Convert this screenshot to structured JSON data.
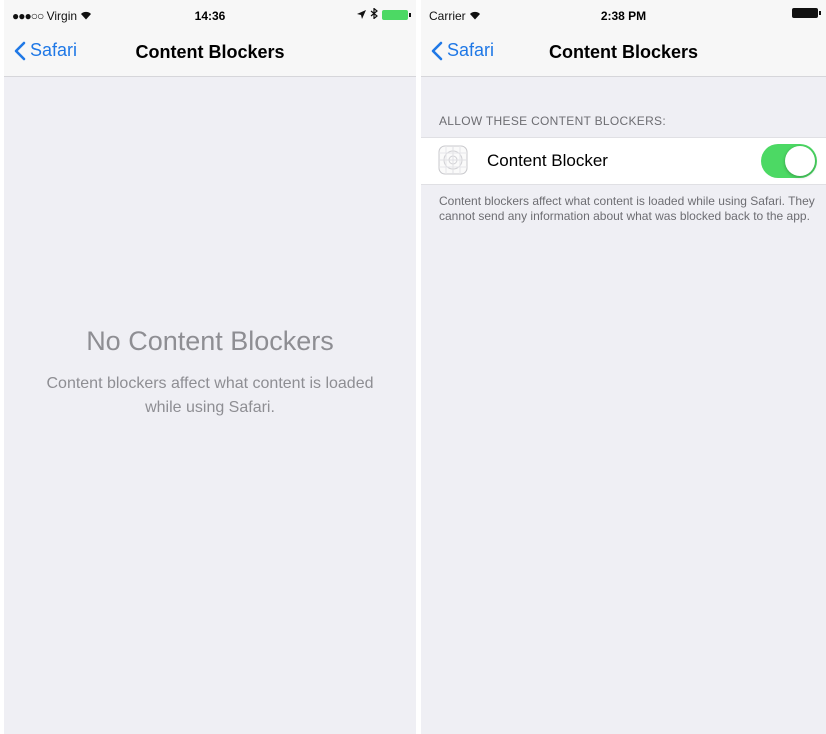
{
  "colors": {
    "accent": "#1f78e6",
    "toggle_on": "#4cd964",
    "battery_green": "#4cd964",
    "background": "#efeff4"
  },
  "left_screen": {
    "status_bar": {
      "carrier": "Virgin",
      "time": "14:36"
    },
    "nav": {
      "back_label": "Safari",
      "title": "Content Blockers"
    },
    "empty_state": {
      "title": "No Content Blockers",
      "description": "Content blockers affect what content is loaded while using Safari."
    }
  },
  "right_screen": {
    "status_bar": {
      "carrier": "Carrier",
      "time": "2:38 PM"
    },
    "nav": {
      "back_label": "Safari",
      "title": "Content Blockers"
    },
    "section_header": "ALLOW THESE CONTENT BLOCKERS:",
    "blockers": [
      {
        "label": "Content Blocker",
        "enabled": true,
        "icon": "app-placeholder-icon"
      }
    ],
    "footer": "Content blockers affect what content is loaded while using Safari. They cannot send any information about what was blocked back to the app."
  }
}
